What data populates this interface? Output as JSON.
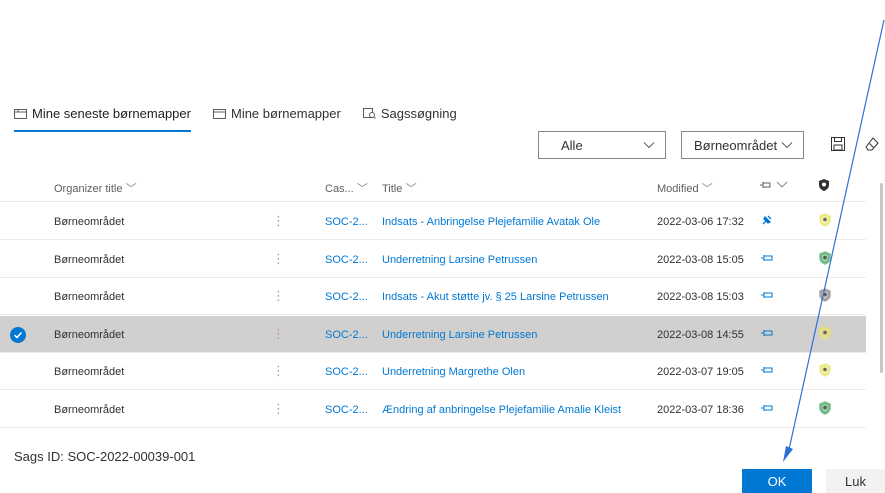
{
  "tabs": [
    {
      "label": "Mine seneste børnemapper",
      "icon": "folder-icon",
      "active": true
    },
    {
      "label": "Mine børnemapper",
      "icon": "folder-icon",
      "active": false
    },
    {
      "label": "Sagssøgning",
      "icon": "search-doc-icon",
      "active": false
    }
  ],
  "filters": {
    "scope": "Alle",
    "area": "Børneområdet"
  },
  "columns": {
    "org": "Organizer title",
    "case": "Cas...",
    "title": "Title",
    "modified": "Modified"
  },
  "rows": [
    {
      "org": "Børneområdet",
      "case": "SOC-2...",
      "title": "Indsats - Anbringelse Plejefamilie Avatak Ole",
      "modified": "2022-03-06 17:32",
      "pinned": true,
      "shield": "yellow",
      "selected": false
    },
    {
      "org": "Børneområdet",
      "case": "SOC-2...",
      "title": "Underretning Larsine Petrussen",
      "modified": "2022-03-08 15:05",
      "pinned": false,
      "shield": "green",
      "selected": false
    },
    {
      "org": "Børneområdet",
      "case": "SOC-2...",
      "title": "Indsats - Akut støtte jv. § 25 Larsine Petrussen",
      "modified": "2022-03-08 15:03",
      "pinned": false,
      "shield": "gray",
      "selected": false
    },
    {
      "org": "Børneområdet",
      "case": "SOC-2...",
      "title": "Underretning Larsine Petrussen",
      "modified": "2022-03-08 14:55",
      "pinned": false,
      "shield": "yellow",
      "selected": true
    },
    {
      "org": "Børneområdet",
      "case": "SOC-2...",
      "title": "Underretning Margrethe Olen",
      "modified": "2022-03-07 19:05",
      "pinned": false,
      "shield": "yellow",
      "selected": false
    },
    {
      "org": "Børneområdet",
      "case": "SOC-2...",
      "title": "Ændring af anbringelse Plejefamilie Amalie Kleist",
      "modified": "2022-03-07 18:36",
      "pinned": false,
      "shield": "green",
      "selected": false
    }
  ],
  "footer": {
    "sags_id": "Sags ID: SOC-2022-00039-001",
    "ok_label": "OK",
    "close_label": "Luk"
  },
  "colors": {
    "accent": "#0078d4",
    "selected_row": "#d2d0ce",
    "shield_yellow": "#e8e36a",
    "shield_green": "#4aa564",
    "shield_gray": "#8a8886"
  }
}
